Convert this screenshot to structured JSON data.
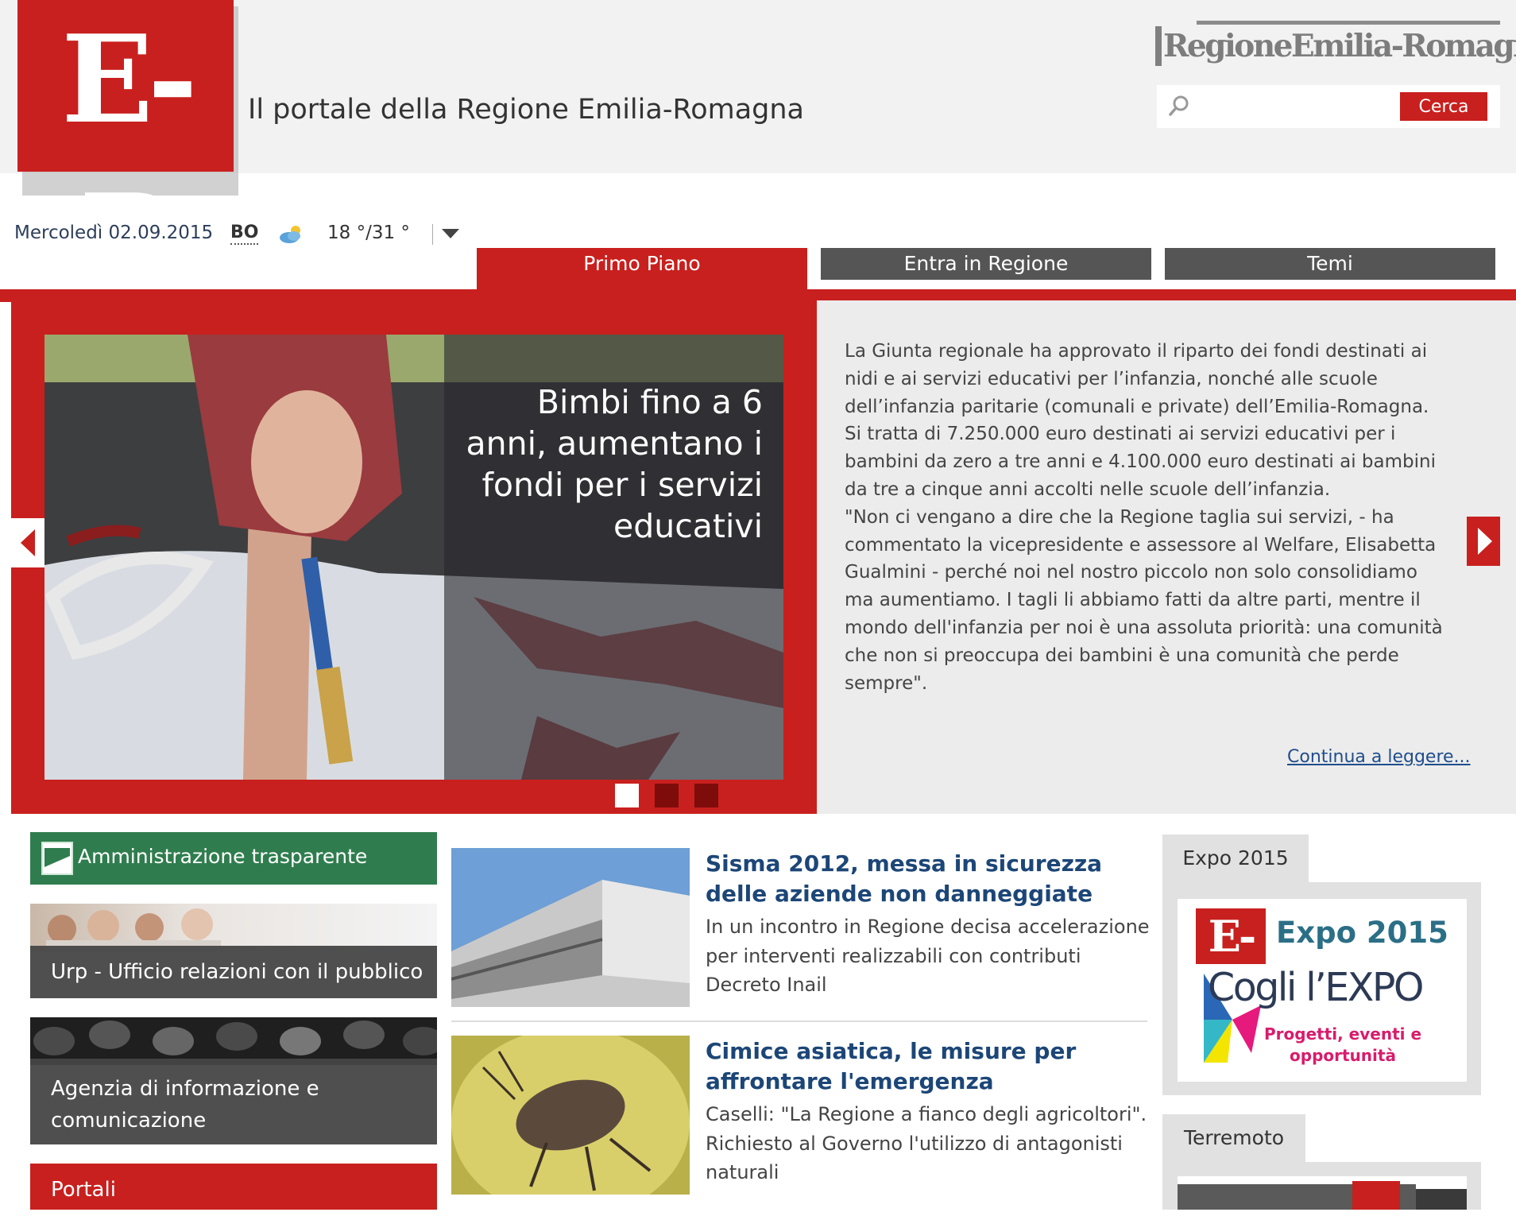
{
  "header": {
    "logo_text": "E-R",
    "site_title": "Il portale della Regione Emilia-Romagna",
    "region_logo_text": "RegioneEmilia-Romagna",
    "search_placeholder": "",
    "search_button": "Cerca"
  },
  "infobar": {
    "date": "Mercoledì 02.09.2015",
    "city": "BO",
    "weather_icon": "partly-cloudy-icon",
    "temperature": "18 °/31 °"
  },
  "tabs": [
    {
      "label": "Primo Piano",
      "active": true
    },
    {
      "label": "Entra in Regione",
      "active": false
    },
    {
      "label": "Temi",
      "active": false
    }
  ],
  "featured": {
    "headline": "Bimbi fino a 6 anni, aumentano i fondi per i servizi educativi",
    "body": [
      "La Giunta regionale ha approvato il riparto dei fondi destinati ai nidi e ai servizi educativi per l’infanzia, nonché alle scuole dell’infanzia paritarie (comunali e private) dell’Emilia-Romagna. Si tratta di 7.250.000 euro destinati ai servizi educativi per i bambini da zero a tre anni e 4.100.000 euro destinati ai bambini da tre a cinque anni accolti nelle scuole dell’infanzia.",
      "\"Non ci vengano a dire che la Regione taglia sui servizi, - ha commentato la vicepresidente e assessore al Welfare, Elisabetta Gualmini - perché noi nel nostro piccolo non solo consolidiamo ma aumentiamo. I tagli li abbiamo fatti da altre parti, mentre il mondo dell'infanzia per noi è una assoluta priorità: una comunità che non si preoccupa dei bambini è una comunità che perde sempre\"."
    ],
    "read_more": "Continua a leggere...",
    "slides_total": 3,
    "slide_active": 1
  },
  "left": {
    "amministrazione": "Amministrazione trasparente",
    "urp": "Urp - Ufficio relazioni con il pubblico",
    "agenzia": "Agenzia di informazione e comunicazione",
    "portali": "Portali"
  },
  "news": [
    {
      "title": "Sisma 2012, messa in sicurezza delle aziende non danneggiate",
      "text": "In un incontro in Regione decisa accelerazione per interventi realizzabili con contributi Decreto Inail"
    },
    {
      "title": "Cimice asiatica, le misure per affrontare l'emergenza",
      "text": "Caselli: \"La Regione a fianco degli agricoltori\". Richiesto al Governo l'utilizzo di antagonisti naturali"
    }
  ],
  "right": {
    "expo_tab": "Expo 2015",
    "expo_logo": "E-R",
    "expo_title": "Expo 2015",
    "expo_cogli": "Cogli l’EXPO",
    "expo_sub": "Progetti, eventi e opportunità",
    "terremoto_tab": "Terremoto"
  },
  "colors": {
    "brand_red": "#c8201e",
    "tab_gray": "#555555",
    "green": "#2f7d4e",
    "link_blue": "#1c4677"
  }
}
